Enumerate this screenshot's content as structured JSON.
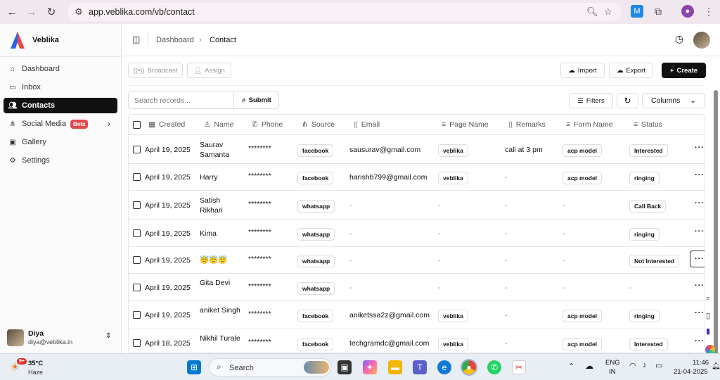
{
  "browser": {
    "url": "app.veblika.com/vb/contact"
  },
  "sidebar": {
    "brand": "Veblika",
    "items": [
      {
        "label": "Dashboard",
        "icon": "home-icon"
      },
      {
        "label": "Inbox",
        "icon": "inbox-icon"
      },
      {
        "label": "Contacts",
        "icon": "users-icon",
        "active": true
      },
      {
        "label": "Social Media",
        "icon": "share-icon",
        "badge": "Beta"
      },
      {
        "label": "Gallery",
        "icon": "image-icon"
      },
      {
        "label": "Settings",
        "icon": "settings-icon"
      }
    ],
    "user": {
      "name": "Diya",
      "email": "diya@veblika.in"
    }
  },
  "header": {
    "breadcrumb": [
      "Dashboard",
      "Contact"
    ]
  },
  "toolbar": {
    "broadcast": "Broadcast",
    "assign": "Assign",
    "import": "Import",
    "export": "Export",
    "create": "Create",
    "search_placeholder": "Search records...",
    "submit": "Submit",
    "filters": "Filters",
    "columns": "Columns"
  },
  "table": {
    "columns": [
      "Created",
      "Name",
      "Phone",
      "Source",
      "Email",
      "Page Name",
      "Remarks",
      "Form Name",
      "Status"
    ],
    "rows": [
      {
        "created": "April 19, 2025",
        "name": "Saurav Samanta",
        "phone": "********",
        "source": "facebook",
        "email": "sausurav@gmail.com",
        "page": "veblika",
        "remarks": "call at 3 pm",
        "form": "acp model",
        "status": "Interested"
      },
      {
        "created": "April 19, 2025",
        "name": "Harry",
        "phone": "********",
        "source": "facebook",
        "email": "harishb799@gmail.com",
        "page": "veblika",
        "remarks": "-",
        "form": "acp model",
        "status": "ringing"
      },
      {
        "created": "April 19, 2025",
        "name": "Satish Rikhari",
        "phone": "********",
        "source": "whatsapp",
        "email": "-",
        "page": "-",
        "remarks": "-",
        "form": "-",
        "status": "Call Back"
      },
      {
        "created": "April 19, 2025",
        "name": "Kima",
        "phone": "********",
        "source": "whatsapp",
        "email": "-",
        "page": "-",
        "remarks": "-",
        "form": "-",
        "status": "ringing"
      },
      {
        "created": "April 19, 2025",
        "name": "😇😇😇",
        "phone": "********",
        "source": "whatsapp",
        "email": "-",
        "page": "-",
        "remarks": "-",
        "form": "-",
        "status": "Not Interested"
      },
      {
        "created": "April 19, 2025",
        "name": "Gita Devi",
        "phone": "********",
        "source": "whatsapp",
        "email": "-",
        "page": "-",
        "remarks": "-",
        "form": "-",
        "status": "-"
      },
      {
        "created": "April 19, 2025",
        "name": "aniket Singh",
        "phone": "********",
        "source": "facebook",
        "email": "aniketssa2z@gmail.com",
        "page": "veblika",
        "remarks": "-",
        "form": "acp model",
        "status": "ringing"
      },
      {
        "created": "April 18, 2025",
        "name": "Nikhil Turale",
        "phone": "********",
        "source": "facebook",
        "email": "techgramdc@gmail.com",
        "page": "veblika",
        "remarks": "-",
        "form": "acp model",
        "status": "Interested"
      }
    ]
  },
  "taskbar": {
    "weather_temp": "35°C",
    "weather_desc": "Haze",
    "weather_badge": "9+",
    "search": "Search",
    "lang_line1": "ENG",
    "lang_line2": "IN",
    "time": "11:46",
    "date": "21-04-2025"
  }
}
